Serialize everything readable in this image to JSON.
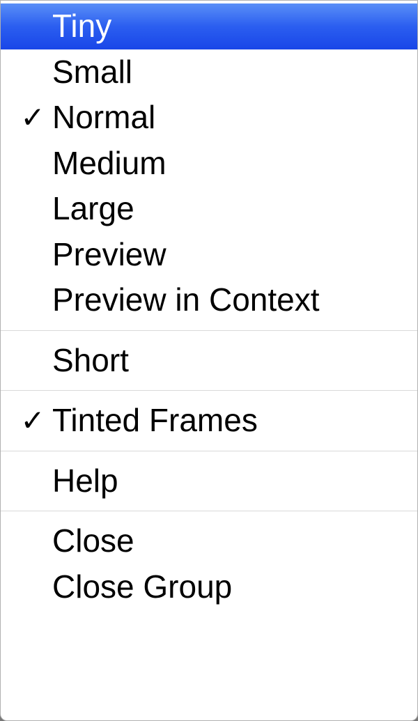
{
  "menu": {
    "groups": [
      {
        "items": [
          {
            "id": "tiny",
            "label": "Tiny",
            "checked": false,
            "highlighted": true
          },
          {
            "id": "small",
            "label": "Small",
            "checked": false,
            "highlighted": false
          },
          {
            "id": "normal",
            "label": "Normal",
            "checked": true,
            "highlighted": false
          },
          {
            "id": "medium",
            "label": "Medium",
            "checked": false,
            "highlighted": false
          },
          {
            "id": "large",
            "label": "Large",
            "checked": false,
            "highlighted": false
          },
          {
            "id": "preview",
            "label": "Preview",
            "checked": false,
            "highlighted": false
          },
          {
            "id": "preview-in-context",
            "label": "Preview in Context",
            "checked": false,
            "highlighted": false
          }
        ]
      },
      {
        "items": [
          {
            "id": "short",
            "label": "Short",
            "checked": false,
            "highlighted": false
          }
        ]
      },
      {
        "items": [
          {
            "id": "tinted-frames",
            "label": "Tinted Frames",
            "checked": true,
            "highlighted": false
          }
        ]
      },
      {
        "items": [
          {
            "id": "help",
            "label": "Help",
            "checked": false,
            "highlighted": false
          }
        ]
      },
      {
        "items": [
          {
            "id": "close",
            "label": "Close",
            "checked": false,
            "highlighted": false
          },
          {
            "id": "close-group",
            "label": "Close Group",
            "checked": false,
            "highlighted": false
          }
        ]
      }
    ]
  }
}
